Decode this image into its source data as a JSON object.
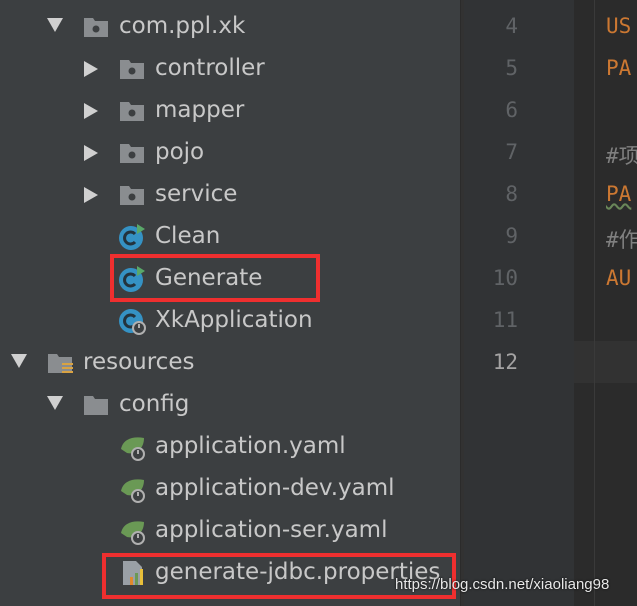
{
  "colors": {
    "tree_bg": "#3c3f41",
    "editor_bg": "#2b2b2b",
    "highlight_box": "#ef2f2f",
    "keyword_orange": "#cc7832",
    "comment_gray": "#808080"
  },
  "project_tree": {
    "rows": [
      {
        "label": "com.ppl.xk",
        "icon": "package-folder-icon",
        "expanded": true
      },
      {
        "label": "controller",
        "icon": "package-folder-icon",
        "expanded": false
      },
      {
        "label": "mapper",
        "icon": "package-folder-icon",
        "expanded": false
      },
      {
        "label": "pojo",
        "icon": "package-folder-icon",
        "expanded": false
      },
      {
        "label": "service",
        "icon": "package-folder-icon",
        "expanded": false
      },
      {
        "label": "Clean",
        "icon": "java-class-runnable-icon"
      },
      {
        "label": "Generate",
        "icon": "java-class-runnable-icon",
        "highlighted": true
      },
      {
        "label": "XkApplication",
        "icon": "spring-boot-application-icon"
      },
      {
        "label": "resources",
        "icon": "resources-folder-icon",
        "expanded": true
      },
      {
        "label": "config",
        "icon": "folder-icon",
        "expanded": true
      },
      {
        "label": "application.yaml",
        "icon": "spring-config-leaf-icon"
      },
      {
        "label": "application-dev.yaml",
        "icon": "spring-config-leaf-icon"
      },
      {
        "label": "application-ser.yaml",
        "icon": "spring-config-leaf-icon"
      },
      {
        "label": "generate-jdbc.properties",
        "icon": "properties-file-icon",
        "highlighted": true
      }
    ]
  },
  "editor": {
    "line_numbers": [
      "4",
      "5",
      "6",
      "7",
      "8",
      "9",
      "10",
      "11",
      "12"
    ],
    "current_line": "12",
    "visible_code": [
      "US",
      "PA",
      "",
      "#项",
      "PA",
      "#作",
      "AU",
      "",
      ""
    ]
  },
  "watermark": {
    "text": "https://blog.csdn.net/xiaoliang98"
  }
}
